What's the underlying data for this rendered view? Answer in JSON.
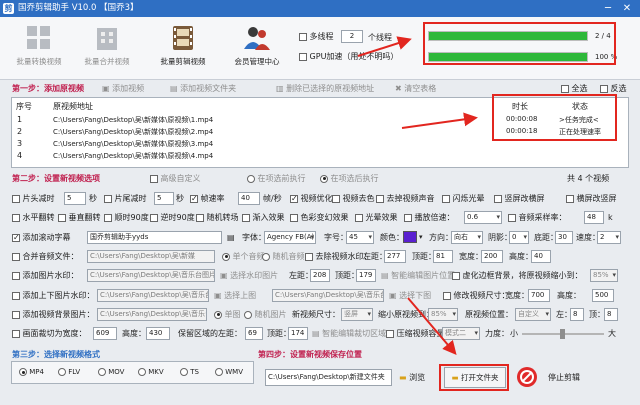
{
  "window": {
    "title": "国乔剪辑助手 V10.0  【国乔3】",
    "min": "─",
    "close": "✕"
  },
  "toolbar": {
    "items": [
      {
        "label": "批量转换视频",
        "enabled": false
      },
      {
        "label": "批量合并视频",
        "enabled": false
      },
      {
        "label": "批量剪辑视频",
        "enabled": true
      },
      {
        "label": "会员管理中心",
        "enabled": true
      }
    ],
    "multithread_label": "多线程",
    "threads_value": "2",
    "threads_unit": "个线程",
    "gpu_label": "GPU加速（用处不明吗）"
  },
  "progress": {
    "bars": [
      {
        "fraction": 1.0,
        "text": "2 / 4"
      },
      {
        "fraction": 1.0,
        "text": "100 %"
      }
    ]
  },
  "step1": {
    "title": "第一步：添加原视频",
    "add_video": "添加视频",
    "add_folder": "添加视频文件夹",
    "delete_selected": "删除已选择的原视频地址",
    "clear_list": "清空表格",
    "select_all": "全选",
    "invert": "反选"
  },
  "table": {
    "headers": [
      "序号",
      "原视频地址",
      "时长",
      "状态"
    ],
    "rows": [
      {
        "no": "1",
        "path": "C:\\Users\\Fang\\Desktop\\吴\\新媒体\\原视频\\1.mp4",
        "duration": "00:00:08",
        "status": ">任务完成<"
      },
      {
        "no": "2",
        "path": "C:\\Users\\Fang\\Desktop\\吴\\新媒体\\原视频\\2.mp4",
        "duration": "00:00:18",
        "status": "正在处理速率"
      },
      {
        "no": "3",
        "path": "C:\\Users\\Fang\\Desktop\\吴\\新媒体\\原视频\\3.mp4",
        "duration": "",
        "status": ""
      },
      {
        "no": "4",
        "path": "C:\\Users\\Fang\\Desktop\\吴\\新媒体\\原视频\\4.mp4",
        "duration": "",
        "status": ""
      }
    ]
  },
  "step2": {
    "title": "第二步：设置新视频选项",
    "advanced": "高级自定义",
    "before_exec": "在项选前执行",
    "after_exec": "在项选后执行",
    "count": "共 4 个视频"
  },
  "options": {
    "row1": {
      "cut_head": "片头减时",
      "cut_head_val": "5",
      "sec": "秒",
      "cut_tail": "片尾减时",
      "cut_tail_val": "5",
      "sec2": "秒",
      "fps": "帧速率",
      "fps_val": "40",
      "fps_unit": "帧/秒",
      "optimize": "视频优化",
      "decolor": "视频去色",
      "remove_audio": "去掉视频声音",
      "flash": "闪烁光晕",
      "vertical_blur": "竖屏改横屏",
      "horizontal_to_vertical": "横屏改竖屏"
    },
    "row2": {
      "hflip": "水平翻转",
      "vflip": "垂直翻转",
      "rot90": "顺时90度",
      "rot_ccw": "逆时90度",
      "random_transition": "随机转场",
      "fade_in": "渐入效果",
      "color_change": "色彩变幻效果",
      "light": "光晕效果",
      "speed": "播放倍速：",
      "speed_val": "0.6",
      "sample_rate": "音频采样率：",
      "sample_val": "48",
      "sample_unit": "k"
    },
    "row3": {
      "scroll_sub": "添加滚动字幕",
      "sub_text": "国乔剪辑助手yyds",
      "font": "字体：",
      "font_val": "Agency FB(A)",
      "size": "字号：",
      "size_val": "45",
      "color": "颜色：",
      "color_hex": "#5a20d0",
      "direction": "方向：",
      "direction_val": "向右",
      "shadow": "阴影：",
      "shadow_val": "0",
      "bottom": "底距：",
      "bottom_val": "30",
      "speed": "速度：",
      "speed_val": "2"
    },
    "row4": {
      "merge_audio": "合并音频文件：",
      "audio_path": "C:\\Users\\Fang\\Desktop\\吴\\新媒",
      "single_audio": "单个音频",
      "random_audio": "随机音频",
      "remove_watermark": "去除视频水印：",
      "left": "左距：",
      "left_val": "277",
      "top": "顶距：",
      "top_val": "81",
      "width": "宽度：",
      "width_val": "200",
      "height": "高度：",
      "height_val": "40"
    },
    "row5": {
      "add_pic_watermark": "添加图片水印：",
      "pic_path": "C:\\Users\\Fang\\Desktop\\吴\\音乐台图片水",
      "select_wm": "选择水印图片",
      "left": "左距：",
      "left_val": "208",
      "top": "顶距：",
      "top_val": "179",
      "smart_edit": "智能编辑图片位置",
      "blur_bg": "虚化边框背景，将原视频缩小到：",
      "blur_val": "85%"
    },
    "row6": {
      "add_top_pic": "添加上下图片水印：",
      "top_path": "C:\\Users\\Fang\\Desktop\\吴\\音乐台图",
      "select_top": "选择上图",
      "bottom_path": "C:\\Users\\Fang\\Desktop\\吴\\音乐台",
      "select_bottom": "选择下图",
      "modify_size": "修改视频尺寸：",
      "width": "宽度：",
      "width_val": "700",
      "height": "高度：",
      "height_val": "500"
    },
    "row7": {
      "add_bg_pic": "添加视频背景图片：",
      "bg_path": "C:\\Users\\Fang\\Desktop\\吴\\音乐台图片",
      "single": "单图",
      "random": "随机图片",
      "new_size": "新视频尺寸：",
      "new_size_val": "竖屏",
      "shrink": "缩小原视频到：",
      "shrink_val": "85%",
      "position": "原视频位置：",
      "position_val": "自定义",
      "left": "左：",
      "left_val": "8",
      "top": "顶：",
      "top_val": "8"
    },
    "row8": {
      "crop": "画面裁切为宽度：",
      "crop_w": "609",
      "height": "高度：",
      "height_val": "430",
      "keep": "保留区域的左距：",
      "keep_val": "69",
      "top": "顶距：",
      "top_val": "174",
      "smart_crop": "智能编辑裁切区域",
      "compress": "压缩视频容量",
      "mode_val": "模式二",
      "strength": "力度：",
      "small": "小",
      "big": "大"
    }
  },
  "step3": {
    "title": "第三步：选择新视频格式",
    "formats": [
      "MP4",
      "FLV",
      "MOV",
      "MKV",
      "TS",
      "WMV"
    ],
    "selected": "MP4"
  },
  "step4": {
    "title": "第四步：设置新视频保存位置",
    "path": "C:\\Users\\Fang\\Desktop\\新建文件夹",
    "browse": "浏览",
    "open_folder": "打开文件夹",
    "stop": "停止剪辑"
  },
  "colors": {
    "accent": "#2f6fc3",
    "section": "#c0204f",
    "progress": "#2eb83a",
    "annotation": "#e2261f"
  }
}
